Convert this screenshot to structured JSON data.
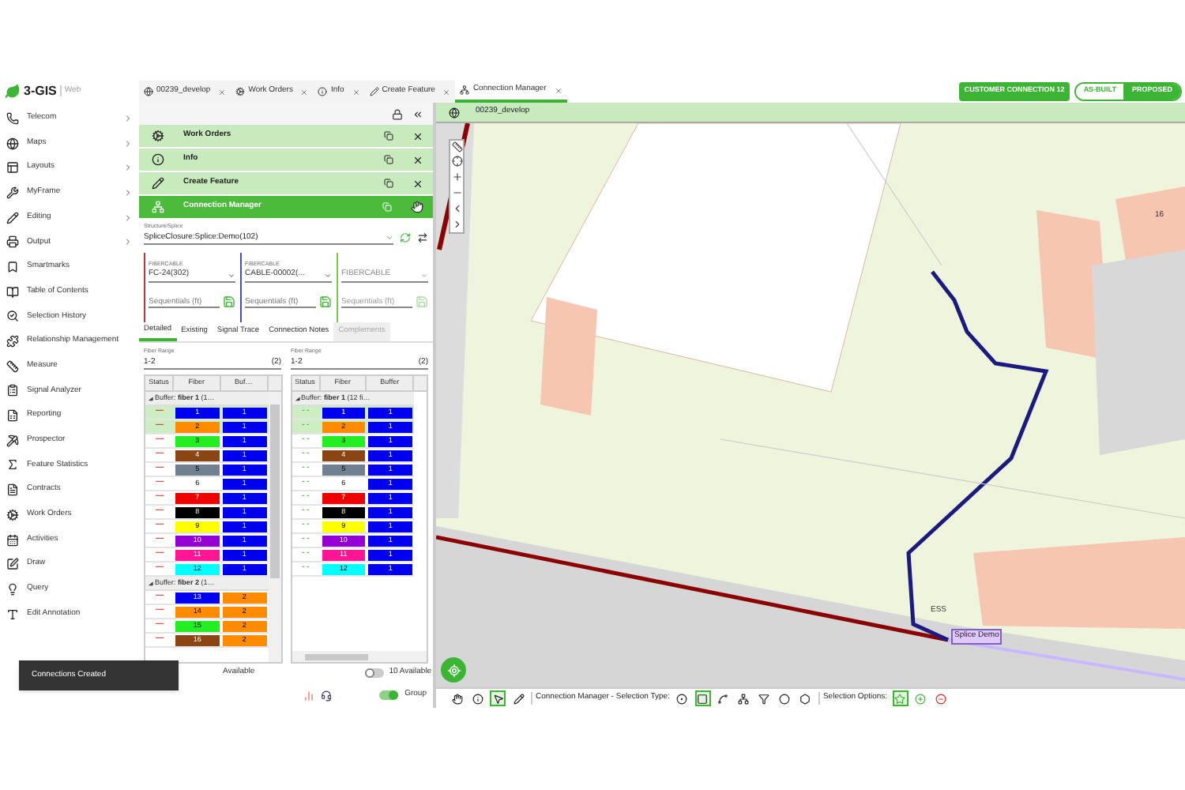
{
  "app": {
    "logo": "3-GIS",
    "product": "Web"
  },
  "tabs": [
    {
      "label": "00239_develop",
      "selected": false
    },
    {
      "label": "Work Orders",
      "selected": false
    },
    {
      "label": "Info",
      "selected": false
    },
    {
      "label": "Create Feature",
      "selected": false
    },
    {
      "label": "Connection Manager",
      "selected": true
    }
  ],
  "header": {
    "customer": "CUSTOMER CONNECTION 12",
    "modes": [
      {
        "label": "AS-BUILT",
        "selected": false
      },
      {
        "label": "PROPOSED",
        "selected": true
      }
    ]
  },
  "sidebar": [
    {
      "label": "Telecom",
      "submenu": true
    },
    {
      "label": "Maps",
      "submenu": true
    },
    {
      "label": "Layouts",
      "submenu": true
    },
    {
      "label": "MyFrame",
      "submenu": true
    },
    {
      "label": "Editing",
      "submenu": true
    },
    {
      "label": "Output",
      "submenu": true
    },
    {
      "label": "Smartmarks",
      "submenu": false
    },
    {
      "label": "Table of Contents",
      "submenu": false
    },
    {
      "label": "Selection History",
      "submenu": false
    },
    {
      "label": "Relationship Management",
      "submenu": false
    },
    {
      "label": "Measure",
      "submenu": false
    },
    {
      "label": "Signal Analyzer",
      "submenu": false
    },
    {
      "label": "Reporting",
      "submenu": false
    },
    {
      "label": "Prospector",
      "submenu": false
    },
    {
      "label": "Feature Statistics",
      "submenu": false
    },
    {
      "label": "Contracts",
      "submenu": false
    },
    {
      "label": "Work Orders",
      "submenu": false
    },
    {
      "label": "Activities",
      "submenu": false
    },
    {
      "label": "Draw",
      "submenu": false
    },
    {
      "label": "Query",
      "submenu": false
    },
    {
      "label": "Edit Annotation",
      "submenu": false
    }
  ],
  "panel": {
    "widgets": [
      {
        "label": "Work Orders",
        "selected": false
      },
      {
        "label": "Info",
        "selected": false
      },
      {
        "label": "Create Feature",
        "selected": false
      },
      {
        "label": "Connection Manager",
        "selected": true
      }
    ],
    "structure": {
      "label": "Structure/Splice",
      "value": "SpliceClosure:Splice:Demo(102)"
    },
    "cables": [
      {
        "label": "FIBERCABLE",
        "value": "FC-24(302)",
        "placeholder": "Sequentials (ft)",
        "color": "#b33a3a",
        "disabled": false
      },
      {
        "label": "FIBERCABLE",
        "value": "CABLE-00002(...",
        "placeholder": "Sequentials (ft)",
        "color": "#4b4bb5",
        "disabled": false
      },
      {
        "value": "FIBERCABLE",
        "placeholder": "Sequentials (ft)",
        "color": "#7cc44a",
        "disabled": true
      }
    ],
    "subtabs": [
      {
        "label": "Detailed",
        "selected": true,
        "disabled": false
      },
      {
        "label": "Existing",
        "selected": false,
        "disabled": false
      },
      {
        "label": "Signal Trace",
        "selected": false,
        "disabled": false
      },
      {
        "label": "Connection Notes",
        "selected": false,
        "disabled": false
      },
      {
        "label": "Complements",
        "selected": false,
        "disabled": true
      }
    ],
    "ranges": [
      {
        "label": "Fiber Range",
        "value": "1-2",
        "count": "(2)"
      },
      {
        "label": "Fiber Range",
        "value": "1-2",
        "count": "(2)"
      }
    ],
    "tables": [
      {
        "kind": "connected",
        "columns": [
          "Status",
          "Fiber",
          "Buf…"
        ],
        "groups": [
          {
            "label": "Buffer: **fiber 1** (1…",
            "color": "#0000ee",
            "rows": [
              {
                "status": "—",
                "fiber": "1",
                "color": "#0000ee",
                "buffer": "1",
                "selected": true
              },
              {
                "status": "—",
                "fiber": "2",
                "color": "#ff8c00",
                "buffer": "1",
                "selected": true
              },
              {
                "status": "—",
                "fiber": "3",
                "color": "#22ee22",
                "buffer": "1",
                "selected": false
              },
              {
                "status": "—",
                "fiber": "4",
                "color": "#8b4513",
                "buffer": "1",
                "selected": false
              },
              {
                "status": "—",
                "fiber": "5",
                "color": "#708090",
                "buffer": "1",
                "selected": false
              },
              {
                "status": "—",
                "fiber": "6",
                "color": "#ffffff",
                "buffer": "1",
                "selected": false
              },
              {
                "status": "—",
                "fiber": "7",
                "color": "#ee0000",
                "buffer": "1",
                "selected": false
              },
              {
                "status": "—",
                "fiber": "8",
                "color": "#000000",
                "buffer": "1",
                "selected": false
              },
              {
                "status": "—",
                "fiber": "9",
                "color": "#ffff00",
                "buffer": "1",
                "selected": false
              },
              {
                "status": "—",
                "fiber": "10",
                "color": "#9400d3",
                "buffer": "1",
                "selected": false
              },
              {
                "status": "—",
                "fiber": "11",
                "color": "#ff1493",
                "buffer": "1",
                "selected": false
              },
              {
                "status": "—",
                "fiber": "12",
                "color": "#00ffff",
                "buffer": "1",
                "selected": false
              }
            ]
          },
          {
            "label": "Buffer: **fiber 2** (1…",
            "color": "#ff8c00",
            "rows": [
              {
                "status": "—",
                "fiber": "13",
                "color": "#0000ee",
                "buffer": "2",
                "selected": false
              },
              {
                "status": "—",
                "fiber": "14",
                "color": "#ff8c00",
                "buffer": "2",
                "selected": false
              },
              {
                "status": "—",
                "fiber": "15",
                "color": "#22ee22",
                "buffer": "2",
                "selected": false
              },
              {
                "status": "—",
                "fiber": "16",
                "color": "#8b4513",
                "buffer": "2",
                "selected": false
              }
            ]
          }
        ]
      },
      {
        "kind": "open",
        "columns": [
          "Status",
          "Fiber",
          "Buffer"
        ],
        "groups": [
          {
            "label": "Buffer: **fiber 1** (12 fi…",
            "color": "#0000ee",
            "rows": [
              {
                "status": "- -",
                "fiber": "1",
                "color": "#0000ee",
                "buffer": "1",
                "selected": true
              },
              {
                "status": "- -",
                "fiber": "2",
                "color": "#ff8c00",
                "buffer": "1",
                "selected": true
              },
              {
                "status": "- -",
                "fiber": "3",
                "color": "#22ee22",
                "buffer": "1",
                "selected": false
              },
              {
                "status": "- -",
                "fiber": "4",
                "color": "#8b4513",
                "buffer": "1",
                "selected": false
              },
              {
                "status": "- -",
                "fiber": "5",
                "color": "#708090",
                "buffer": "1",
                "selected": false
              },
              {
                "status": "- -",
                "fiber": "6",
                "color": "#ffffff",
                "buffer": "1",
                "selected": false
              },
              {
                "status": "- -",
                "fiber": "7",
                "color": "#ee0000",
                "buffer": "1",
                "selected": false
              },
              {
                "status": "- -",
                "fiber": "8",
                "color": "#000000",
                "buffer": "1",
                "selected": false
              },
              {
                "status": "- -",
                "fiber": "9",
                "color": "#ffff00",
                "buffer": "1",
                "selected": false
              },
              {
                "status": "- -",
                "fiber": "10",
                "color": "#9400d3",
                "buffer": "1",
                "selected": false
              },
              {
                "status": "- -",
                "fiber": "11",
                "color": "#ff1493",
                "buffer": "1",
                "selected": false
              },
              {
                "status": "- -",
                "fiber": "12",
                "color": "#00ffff",
                "buffer": "1",
                "selected": false
              }
            ]
          }
        ]
      }
    ],
    "available": [
      {
        "label": "Available"
      },
      {
        "label": "10 Available",
        "on": false
      }
    ],
    "group": {
      "label": "Group",
      "on": true
    }
  },
  "toast": "Connections Created",
  "map": {
    "breadcrumb": "00239_develop",
    "labels": [
      {
        "text": "16",
        "kind": "plain"
      },
      {
        "text": "ESS",
        "kind": "plain"
      },
      {
        "text": "Splice Demo",
        "kind": "callout"
      }
    ],
    "toolbar": {
      "tools": [
        {
          "selected": false
        },
        {
          "selected": false
        },
        {
          "selected": true
        },
        {
          "selected": false
        }
      ],
      "selection_label": "Connection Manager - Selection Type:",
      "types": [
        {
          "selected": false
        },
        {
          "selected": true
        },
        {
          "selected": false
        },
        {
          "selected": false
        },
        {
          "selected": false
        },
        {
          "selected": false
        },
        {
          "selected": false
        }
      ],
      "options_label": "Selection Options:",
      "options": [
        {
          "selected": true
        },
        {
          "selected": false
        },
        {
          "selected": false
        }
      ]
    }
  }
}
